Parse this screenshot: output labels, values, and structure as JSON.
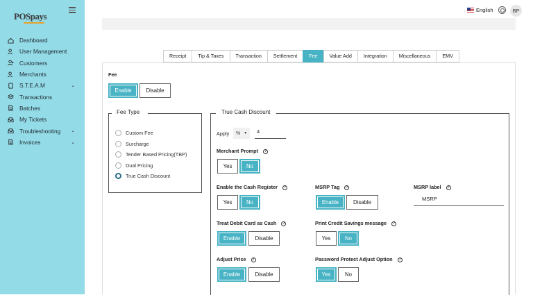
{
  "app": {
    "logo_text": "POSpays"
  },
  "sidebar": {
    "items": [
      {
        "label": "Dashboard",
        "icon": "home-icon"
      },
      {
        "label": "User Management",
        "icon": "users-icon"
      },
      {
        "label": "Customers",
        "icon": "user-plus-icon"
      },
      {
        "label": "Merchants",
        "icon": "merchants-icon"
      },
      {
        "label": "S.T.E.A.M",
        "icon": "tablet-icon",
        "chevron": "⌄"
      },
      {
        "label": "Transactions",
        "icon": "layers-icon"
      },
      {
        "label": "Batches",
        "icon": "document-icon"
      },
      {
        "label": "My Tickets",
        "icon": "inbox-icon"
      },
      {
        "label": "Troubleshooting",
        "icon": "inbox-icon",
        "chevron": "⌄"
      },
      {
        "label": "Invoices",
        "icon": "document-icon",
        "chevron": "⌄"
      }
    ]
  },
  "header": {
    "language": "English",
    "avatar_initials": "BP"
  },
  "tabs": [
    "Receipt",
    "Tip & Taxes",
    "Transaction",
    "Settlement",
    "Fee",
    "Value Add",
    "Integration",
    "Miscellaneous",
    "EMV"
  ],
  "active_tab": "Fee",
  "fee": {
    "title": "Fee",
    "enable_label": "Enable",
    "disable_label": "Disable"
  },
  "fee_type": {
    "legend": "Fee Type",
    "options": [
      "Custom Fee",
      "Surcharge",
      "Tender Based Pricing(TBP)",
      "Dual Pricing",
      "True Cash Discount"
    ],
    "selected": "True Cash Discount"
  },
  "tcd": {
    "legend": "True Cash Discount",
    "apply_label": "Apply",
    "apply_unit": "%",
    "apply_value": "4",
    "merchant_prompt": "Merchant Prompt",
    "enable_cash_register": "Enable the Cash Register",
    "msrp_tag": "MSRP Tag",
    "msrp_label": "MSRP label",
    "msrp_label_value": "MSRP",
    "treat_debit": "Treat Debit Card as Cash",
    "print_credit": "Print Credit Savings message",
    "adjust_price": "Adjust Price",
    "password_protect": "Password Protect Adjust Option",
    "yes": "Yes",
    "no": "No",
    "enable": "Enable",
    "disable": "Disable",
    "help": "?"
  },
  "colors": {
    "sidebar_bg": "#94dbe8",
    "accent": "#47b3c4"
  }
}
